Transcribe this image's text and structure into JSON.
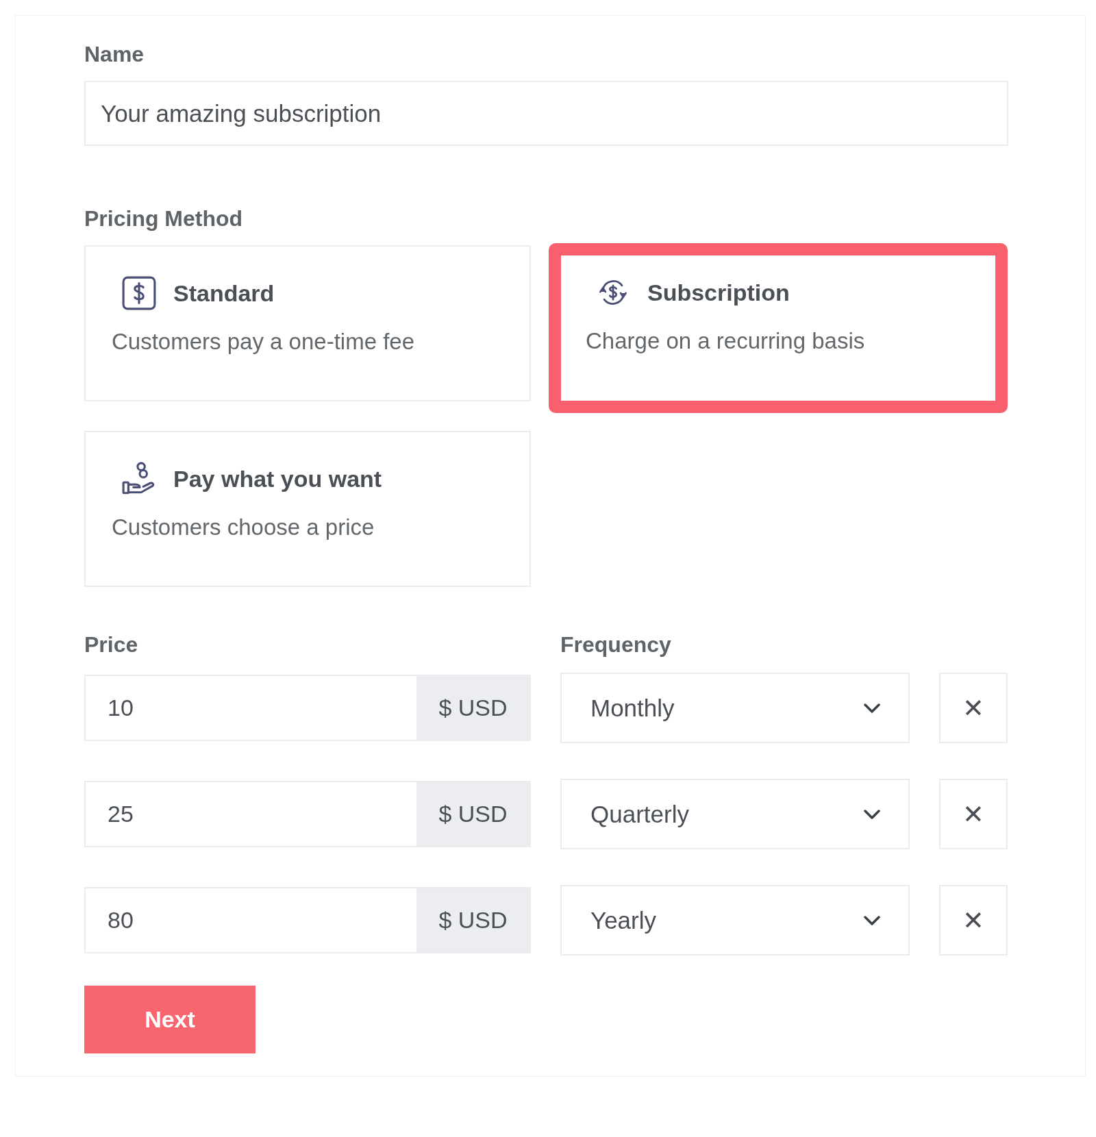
{
  "name_field": {
    "label": "Name",
    "value": "Your amazing subscription"
  },
  "pricing_method": {
    "label": "Pricing Method",
    "options": [
      {
        "kind": "standard",
        "title": "Standard",
        "description": "Customers pay a one-time fee",
        "selected": false
      },
      {
        "kind": "subscription",
        "title": "Subscription",
        "description": "Charge on a recurring basis",
        "selected": true
      },
      {
        "kind": "pwyw",
        "title": "Pay what you want",
        "description": "Customers choose a price",
        "selected": false
      }
    ]
  },
  "prices": {
    "price_label": "Price",
    "frequency_label": "Frequency",
    "rows": [
      {
        "amount": "10",
        "currency": "$ USD",
        "frequency": "Monthly",
        "remove": "✕"
      },
      {
        "amount": "25",
        "currency": "$ USD",
        "frequency": "Quarterly",
        "remove": "✕"
      },
      {
        "amount": "80",
        "currency": "$ USD",
        "frequency": "Yearly",
        "remove": "✕"
      }
    ]
  },
  "next_button": "Next"
}
